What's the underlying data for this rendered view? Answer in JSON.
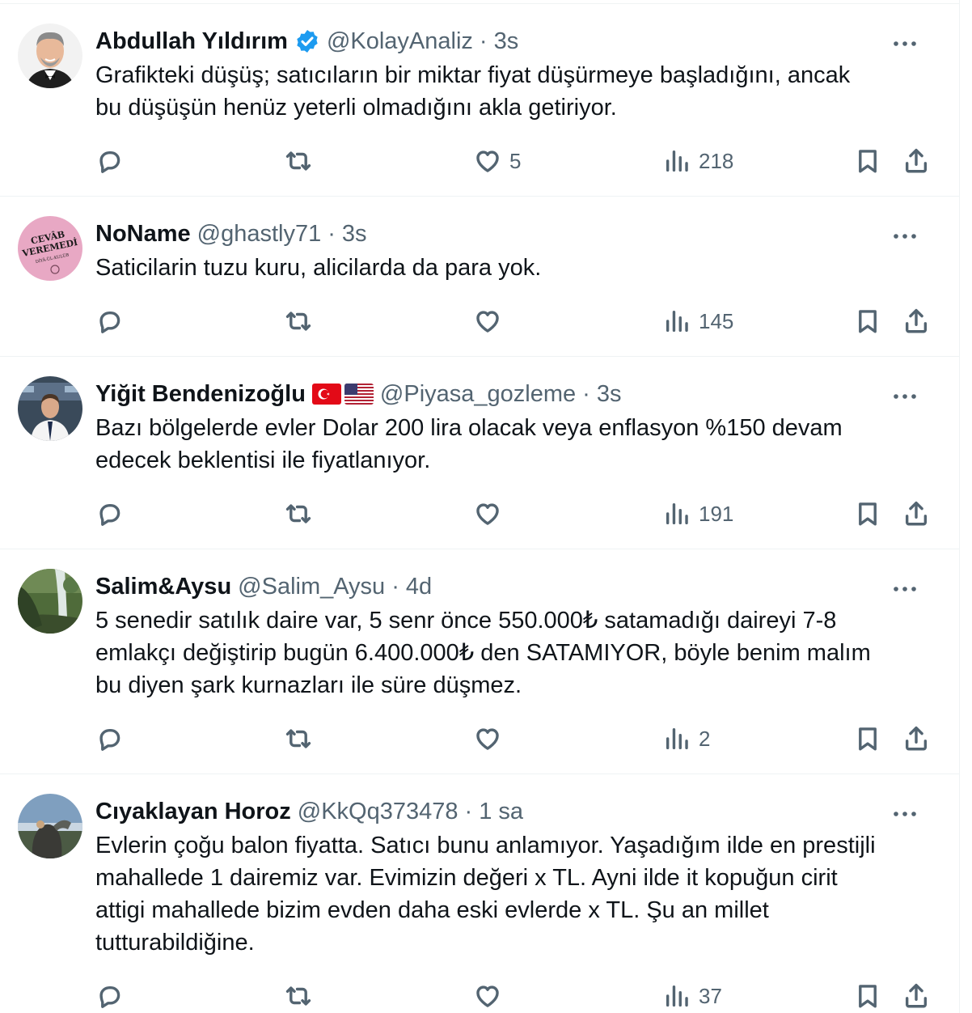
{
  "tweets": [
    {
      "name": "Abdullah Yıldırım",
      "verified": true,
      "handle": "@KolayAnaliz",
      "time": "3s",
      "lines": [
        "Grafikteki düşüş; satıcıların bir miktar fiyat düşürmeye başladığını, ancak",
        "bu düşüşün henüz yeterli olmadığını akla getiriyor."
      ],
      "likes": "5",
      "views": "218"
    },
    {
      "name": "NoName",
      "handle": "@ghastly71",
      "time": "3s",
      "avatar_text": [
        "CEVÂB",
        "VEREMEDİ",
        "DİYÂ-ÜL-KULÛB"
      ],
      "lines": [
        "Saticilarin tuzu kuru, alicilarda da para yok."
      ],
      "likes": "",
      "views": "145"
    },
    {
      "name": "Yiğit Bendenizoğlu",
      "flags": [
        "turkey-flag",
        "usa-flag"
      ],
      "handle": "@Piyasa_gozleme",
      "time": "3s",
      "lines": [
        "Bazı bölgelerde evler Dolar 200 lira olacak veya enflasyon %150 devam",
        "edecek beklentisi ile fiyatlanıyor."
      ],
      "likes": "",
      "views": "191"
    },
    {
      "name": "Salim&Aysu",
      "handle": "@Salim_Aysu",
      "time": "4d",
      "lines": [
        "5 senedir satılık daire var, 5 senr önce 550.000₺ satamadığı daireyi 7-8",
        "emlakçı değiştirip bugün 6.400.000₺ den SATAMIYOR, böyle benim malım",
        "bu diyen şark kurnazları ile süre düşmez."
      ],
      "likes": "",
      "views": "2"
    },
    {
      "name": "Cıyaklayan Horoz",
      "handle": "@KkQq373478",
      "time": "1 sa",
      "lines": [
        "Evlerin çoğu balon fiyatta. Satıcı bunu anlamıyor. Yaşadığım ilde en prestijli",
        "mahallede 1 dairemiz var. Evimizin değeri x TL. Ayni ilde it kopuğun cirit",
        "attigi mahallede bizim evden daha eski evlerde x TL. Şu an millet",
        "tutturabildiğine."
      ],
      "likes": "",
      "views": "37"
    }
  ],
  "separator": "·",
  "icons": {
    "more": "more-dots-icon",
    "reply": "reply-bubble-icon",
    "retweet": "retweet-arrows-icon",
    "like": "heart-icon",
    "views": "analytics-bars-icon",
    "bookmark": "bookmark-icon",
    "share": "share-upload-icon",
    "verified": "verified-badge-icon"
  },
  "colors": {
    "text": "#0f1419",
    "secondary": "#536471",
    "border": "#eff3f4",
    "verified": "#1d9bf0"
  }
}
